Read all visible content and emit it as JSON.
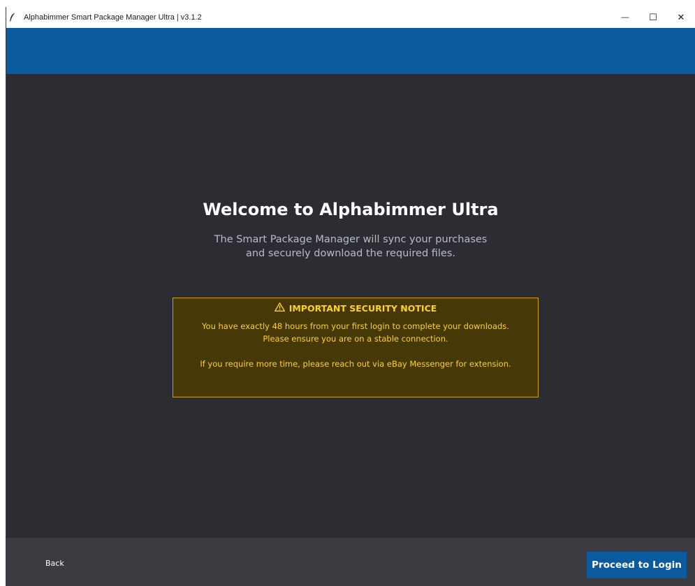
{
  "window": {
    "title": "Alphabimmer Smart Package Manager Ultra | v3.1.2",
    "controls": {
      "minimize": "—",
      "maximize": "☐",
      "close": "✕"
    }
  },
  "main": {
    "heading": "Welcome to Alphabimmer Ultra",
    "subtitle_line1": "The Smart Package Manager will sync your purchases",
    "subtitle_line2": "and securely download the required files."
  },
  "notice": {
    "icon": "warning-icon",
    "title": "IMPORTANT SECURITY NOTICE",
    "line1": "You have exactly 48 hours from your first login to complete your downloads.",
    "line2": "Please ensure you are on a stable connection.",
    "line3": "If you require more time, please reach out via eBay Messenger for extension."
  },
  "footer": {
    "back_label": "Back",
    "proceed_label": "Proceed to Login"
  },
  "colors": {
    "accent": "#0b5a9e",
    "background": "#2b2d33",
    "footer": "#3a3c42",
    "notice_bg": "#473907",
    "notice_border": "#c9a400",
    "notice_text": "#ffd21f"
  }
}
